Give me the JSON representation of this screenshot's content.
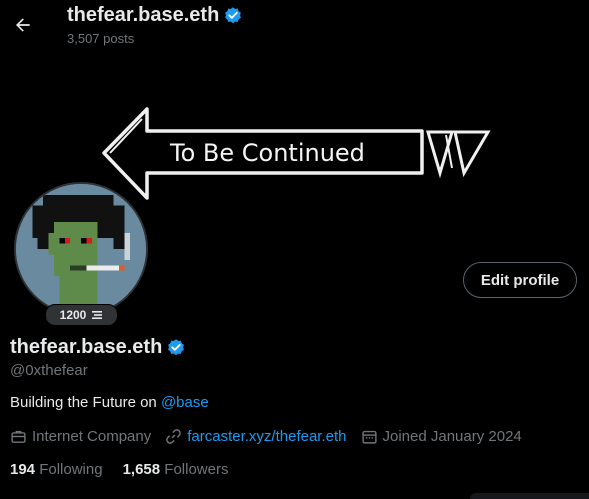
{
  "header": {
    "name": "thefear.base.eth",
    "posts": "3,507 posts"
  },
  "banner": {
    "text": "To Be Continued"
  },
  "avatar": {
    "level": "1200"
  },
  "profile": {
    "display_name": "thefear.base.eth",
    "handle": "@0xthefear",
    "bio_prefix": "Building the Future on ",
    "bio_mention": "@base",
    "category": "Internet Company",
    "website": "farcaster.xyz/thefear.eth",
    "joined": "Joined January 2024",
    "edit_button": "Edit profile"
  },
  "stats": {
    "following_count": "194",
    "following_label": "Following",
    "followers_count": "1,658",
    "followers_label": "Followers"
  },
  "colors": {
    "accent": "#1d9bf0",
    "background": "#000000",
    "text_primary": "#e7e9ea",
    "text_secondary": "#71767b"
  },
  "icons": {
    "back": "arrow-left-icon",
    "verified": "verified-badge-icon",
    "level": "level-stack-icon",
    "category": "briefcase-icon",
    "website": "link-icon",
    "joined": "calendar-icon"
  }
}
